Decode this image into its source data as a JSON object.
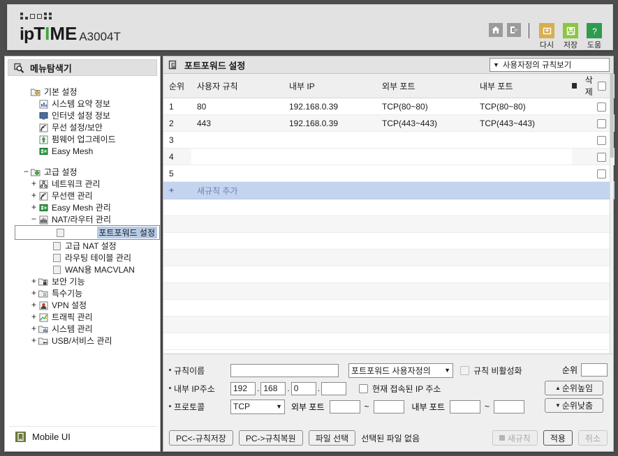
{
  "brand": {
    "name_ip": "ip",
    "name_t": "T",
    "name_i": "I",
    "name_me": "ME",
    "model": "A3004T",
    "icons": [
      {
        "name": "home-icon",
        "label": ""
      },
      {
        "name": "logout-icon",
        "label": ""
      },
      {
        "name": "refresh-icon",
        "label": "다시"
      },
      {
        "name": "save-icon",
        "label": "저장"
      },
      {
        "name": "help-icon",
        "label": "도움"
      }
    ],
    "colors": {
      "refresh": "#d8ae4e",
      "save": "#8cc63f",
      "help": "#2e9b4e",
      "accent": "#3aa93a"
    }
  },
  "sidebar": {
    "title": "메뉴탐색기",
    "title_icon": "search-menu-icon",
    "mobile_ui_label": "Mobile UI",
    "mobile_ui_icon": "mobile-device-icon",
    "tree": [
      {
        "level": 0,
        "expander": "",
        "icon": "folder-basic-icon",
        "label": "기본 설정",
        "selected": false
      },
      {
        "level": 1,
        "expander": "",
        "icon": "chart-icon",
        "label": "시스템 요약 정보",
        "selected": false
      },
      {
        "level": 1,
        "expander": "",
        "icon": "monitor-icon",
        "label": "인터넷 설정 정보",
        "selected": false
      },
      {
        "level": 1,
        "expander": "",
        "icon": "wifi-icon",
        "label": "무선 설정/보안",
        "selected": false
      },
      {
        "level": 1,
        "expander": "",
        "icon": "upgrade-icon",
        "label": "펌웨어 업그레이드",
        "selected": false
      },
      {
        "level": 1,
        "expander": "",
        "icon": "mesh-icon",
        "label": "Easy Mesh",
        "selected": false
      },
      {
        "level": -1,
        "expander": "",
        "icon": "",
        "label": "",
        "selected": false
      },
      {
        "level": 0,
        "expander": "−",
        "icon": "folder-advanced-icon",
        "label": "고급 설정",
        "selected": false
      },
      {
        "level": 1,
        "expander": "+",
        "icon": "network-icon",
        "label": "네트워크 관리",
        "selected": false
      },
      {
        "level": 1,
        "expander": "+",
        "icon": "wifi-icon",
        "label": "무선랜 관리",
        "selected": false
      },
      {
        "level": 1,
        "expander": "+",
        "icon": "mesh-icon",
        "label": "Easy Mesh 관리",
        "selected": false
      },
      {
        "level": 1,
        "expander": "−",
        "icon": "router-icon",
        "label": "NAT/라우터 관리",
        "selected": false
      },
      {
        "level": 2,
        "expander": "",
        "icon": "page-icon",
        "label": "포트포워드 설정",
        "selected": true
      },
      {
        "level": 2,
        "expander": "",
        "icon": "page-icon",
        "label": "고급 NAT 설정",
        "selected": false
      },
      {
        "level": 2,
        "expander": "",
        "icon": "page-icon",
        "label": "라우팅 테이블 관리",
        "selected": false
      },
      {
        "level": 2,
        "expander": "",
        "icon": "page-icon",
        "label": "WAN용 MACVLAN",
        "selected": false
      },
      {
        "level": 1,
        "expander": "+",
        "icon": "lock-icon",
        "label": "보안 기능",
        "selected": false
      },
      {
        "level": 1,
        "expander": "+",
        "icon": "special-icon",
        "label": "특수기능",
        "selected": false
      },
      {
        "level": 1,
        "expander": "+",
        "icon": "vpn-icon",
        "label": "VPN 설정",
        "selected": false
      },
      {
        "level": 1,
        "expander": "+",
        "icon": "traffic-icon",
        "label": "트래픽 관리",
        "selected": false
      },
      {
        "level": 1,
        "expander": "+",
        "icon": "system-icon",
        "label": "시스템 관리",
        "selected": false
      },
      {
        "level": 1,
        "expander": "+",
        "icon": "usb-icon",
        "label": "USB/서비스 관리",
        "selected": false
      }
    ]
  },
  "main": {
    "panel_title": "포트포워드 설정",
    "panel_icon": "copy-page-icon",
    "view_filter": "사용자정의 규칙보기",
    "table": {
      "headers": [
        "순위",
        "사용자 규칙",
        "내부 IP",
        "외부 포트",
        "내부 포트",
        "삭제"
      ],
      "rows": [
        {
          "order": "1",
          "rule": "80",
          "ip": "192.168.0.39",
          "ext_port": "TCP(80~80)",
          "int_port": "TCP(80~80)",
          "checked": false
        },
        {
          "order": "2",
          "rule": "443",
          "ip": "192.168.0.39",
          "ext_port": "TCP(443~443)",
          "int_port": "TCP(443~443)",
          "checked": false
        },
        {
          "order": "3",
          "rule": "",
          "ip": "",
          "ext_port": "",
          "int_port": "",
          "checked": false
        },
        {
          "order": "4",
          "rule": "",
          "ip": "",
          "ext_port": "",
          "int_port": "",
          "checked": false
        },
        {
          "order": "5",
          "rule": "",
          "ip": "",
          "ext_port": "",
          "int_port": "",
          "checked": false
        }
      ],
      "add_row_plus": "+",
      "add_row_label": "새규칙 추가"
    },
    "form": {
      "rule_name_label": "규칙이름",
      "rule_name_value": "",
      "preset_select": "포트포워드 사용자정의",
      "disable_rule_label": "규칙 비활성화",
      "disable_rule_checked": false,
      "internal_ip_label": "내부 IP주소",
      "ip_octets": [
        "192",
        "168",
        "0",
        ""
      ],
      "current_ip_label": "현재 접속된 IP 주소",
      "current_ip_checked": false,
      "protocol_label": "프로토콜",
      "protocol_value": "TCP",
      "ext_port_label": "외부 포트",
      "ext_port_from": "",
      "ext_port_to": "",
      "int_port_label": "내부 포트",
      "int_port_from": "",
      "int_port_to": "",
      "tilde": "~",
      "order_label": "순위",
      "order_value": "",
      "order_up": "순위높임",
      "order_down": "순위낮춤"
    },
    "buttons": {
      "save_to_pc": "PC<-규칙저장",
      "restore_from_pc": "PC->규칙복원",
      "choose_file": "파일 선택",
      "file_status": "선택된 파일 없음",
      "new_rule": "새규칙",
      "apply": "적용",
      "cancel": "취소"
    }
  }
}
